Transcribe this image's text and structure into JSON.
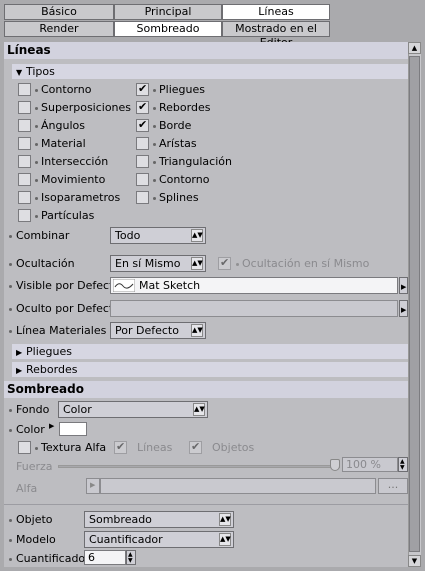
{
  "tabs": [
    {
      "label": "Básico"
    },
    {
      "label": "Principal"
    },
    {
      "label": "Líneas"
    },
    {
      "label": "Render"
    },
    {
      "label": "Sombreado"
    },
    {
      "label": "Mostrado en el Editor"
    }
  ],
  "lineas": {
    "title": "Líneas",
    "tipos": {
      "title": "Tipos",
      "left": [
        {
          "label": "Contorno",
          "checked": false
        },
        {
          "label": "Superposiciones",
          "checked": false
        },
        {
          "label": "Ángulos",
          "checked": false
        },
        {
          "label": "Material",
          "checked": false
        },
        {
          "label": "Intersección",
          "checked": false
        },
        {
          "label": "Movimiento",
          "checked": false
        },
        {
          "label": "Isoparametros",
          "checked": false
        },
        {
          "label": "Partículas",
          "checked": false
        }
      ],
      "right": [
        {
          "label": "Pliegues",
          "checked": true
        },
        {
          "label": "Rebordes",
          "checked": true
        },
        {
          "label": "Borde",
          "checked": true
        },
        {
          "label": "Arístas",
          "checked": false
        },
        {
          "label": "Triangulación",
          "checked": false
        },
        {
          "label": "Contorno",
          "checked": false
        },
        {
          "label": "Splines",
          "checked": false
        }
      ]
    },
    "combinar": {
      "label": "Combinar",
      "value": "Todo"
    },
    "ocultacion": {
      "label": "Ocultación",
      "value": "En sí Mismo",
      "self_label": "Ocultación en sí Mismo"
    },
    "visible": {
      "label": "Visible por Defecto",
      "value": "Mat Sketch"
    },
    "oculto": {
      "label": "Oculto por Defecto"
    },
    "linea_materiales": {
      "label": "Línea Materiales",
      "value": "Por Defecto"
    },
    "pliegues": "Pliegues",
    "rebordes": "Rebordes"
  },
  "sombreado": {
    "title": "Sombreado",
    "fondo": {
      "label": "Fondo",
      "value": "Color"
    },
    "color": {
      "label": "Color",
      "swatch": "#ffffff"
    },
    "textura_alfa": {
      "label": "Textura Alfa",
      "lineas": "Líneas",
      "objetos": "Objetos"
    },
    "fuerza": {
      "label": "Fuerza",
      "value": "100 %"
    },
    "alfa": {
      "label": "Alfa",
      "button": "..."
    },
    "objeto": {
      "label": "Objeto",
      "value": "Sombreado"
    },
    "modelo": {
      "label": "Modelo",
      "value": "Cuantificador"
    },
    "cuantificador": {
      "label": "Cuantificador",
      "value": "6"
    }
  }
}
